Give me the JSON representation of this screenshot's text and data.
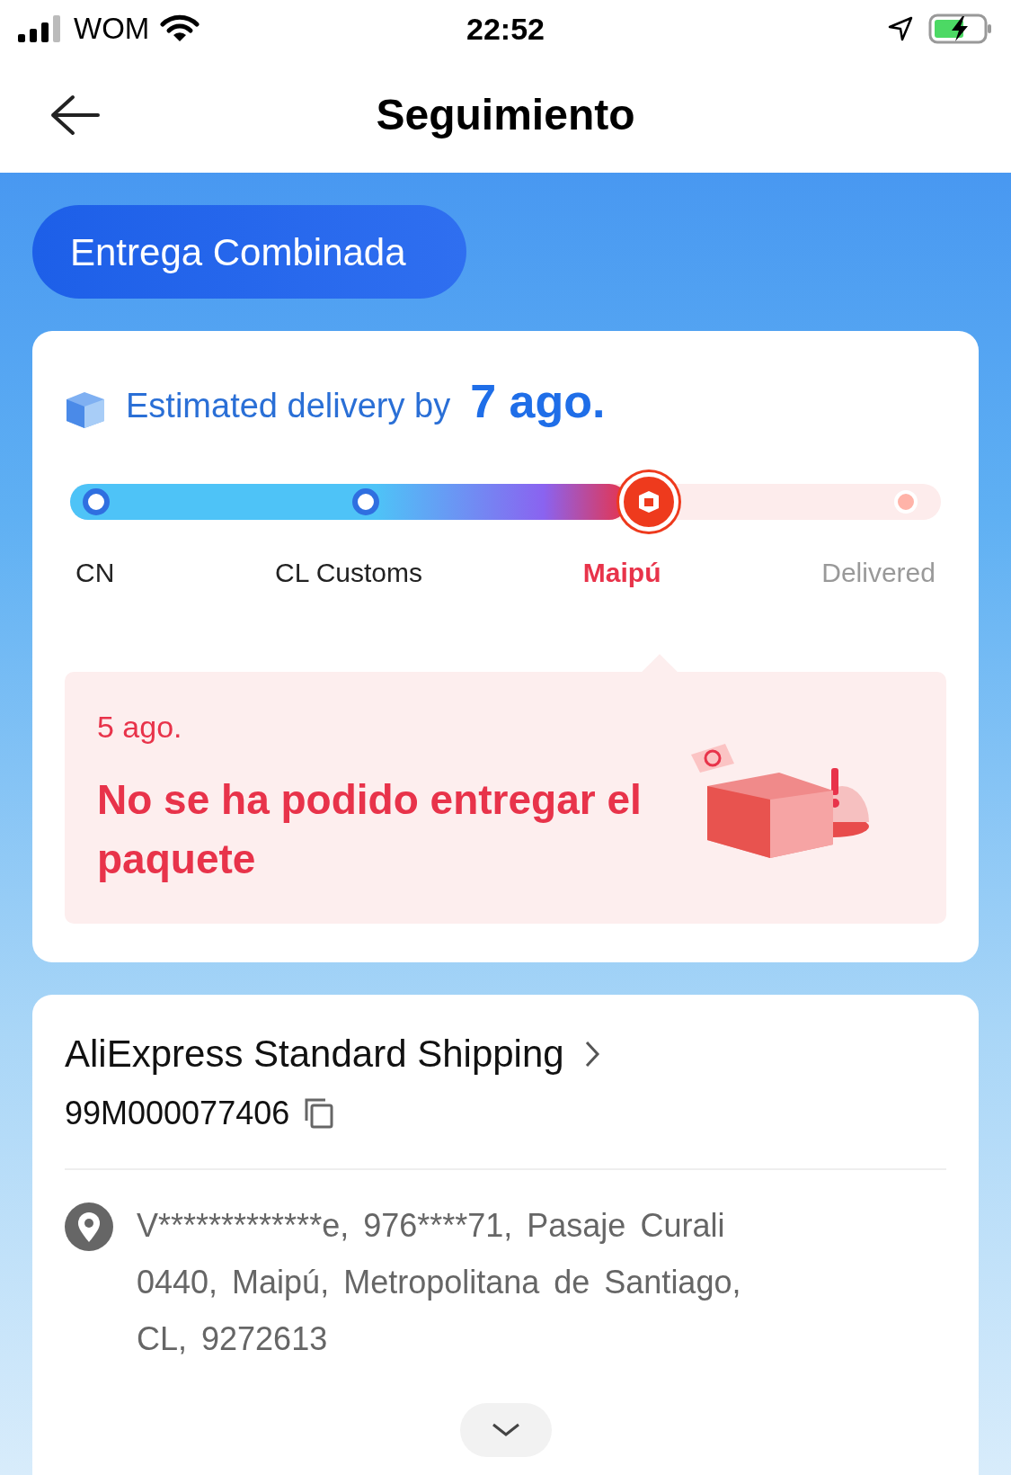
{
  "status_bar": {
    "carrier": "WOM",
    "time": "22:52"
  },
  "header": {
    "title": "Seguimiento"
  },
  "badge": "Entrega Combinada",
  "estimate": {
    "label": "Estimated delivery by",
    "date": "7 ago."
  },
  "progress": {
    "level": 0.64,
    "stages": [
      {
        "label": "CN",
        "kind": "done"
      },
      {
        "label": "CL Customs",
        "kind": "done"
      },
      {
        "label": "Maipú",
        "kind": "current"
      },
      {
        "label": "Delivered",
        "kind": "pending"
      }
    ]
  },
  "event": {
    "date": "5 ago.",
    "message": "No se ha podido entregar el paquete"
  },
  "shipping": {
    "carrier": "AliExpress Standard Shipping",
    "tracking": "99M000077406",
    "address": "V*************e, 976****71, Pasaje Curali 0440, Maipú, Metropolitana de Santiago, CL, 9272613"
  }
}
